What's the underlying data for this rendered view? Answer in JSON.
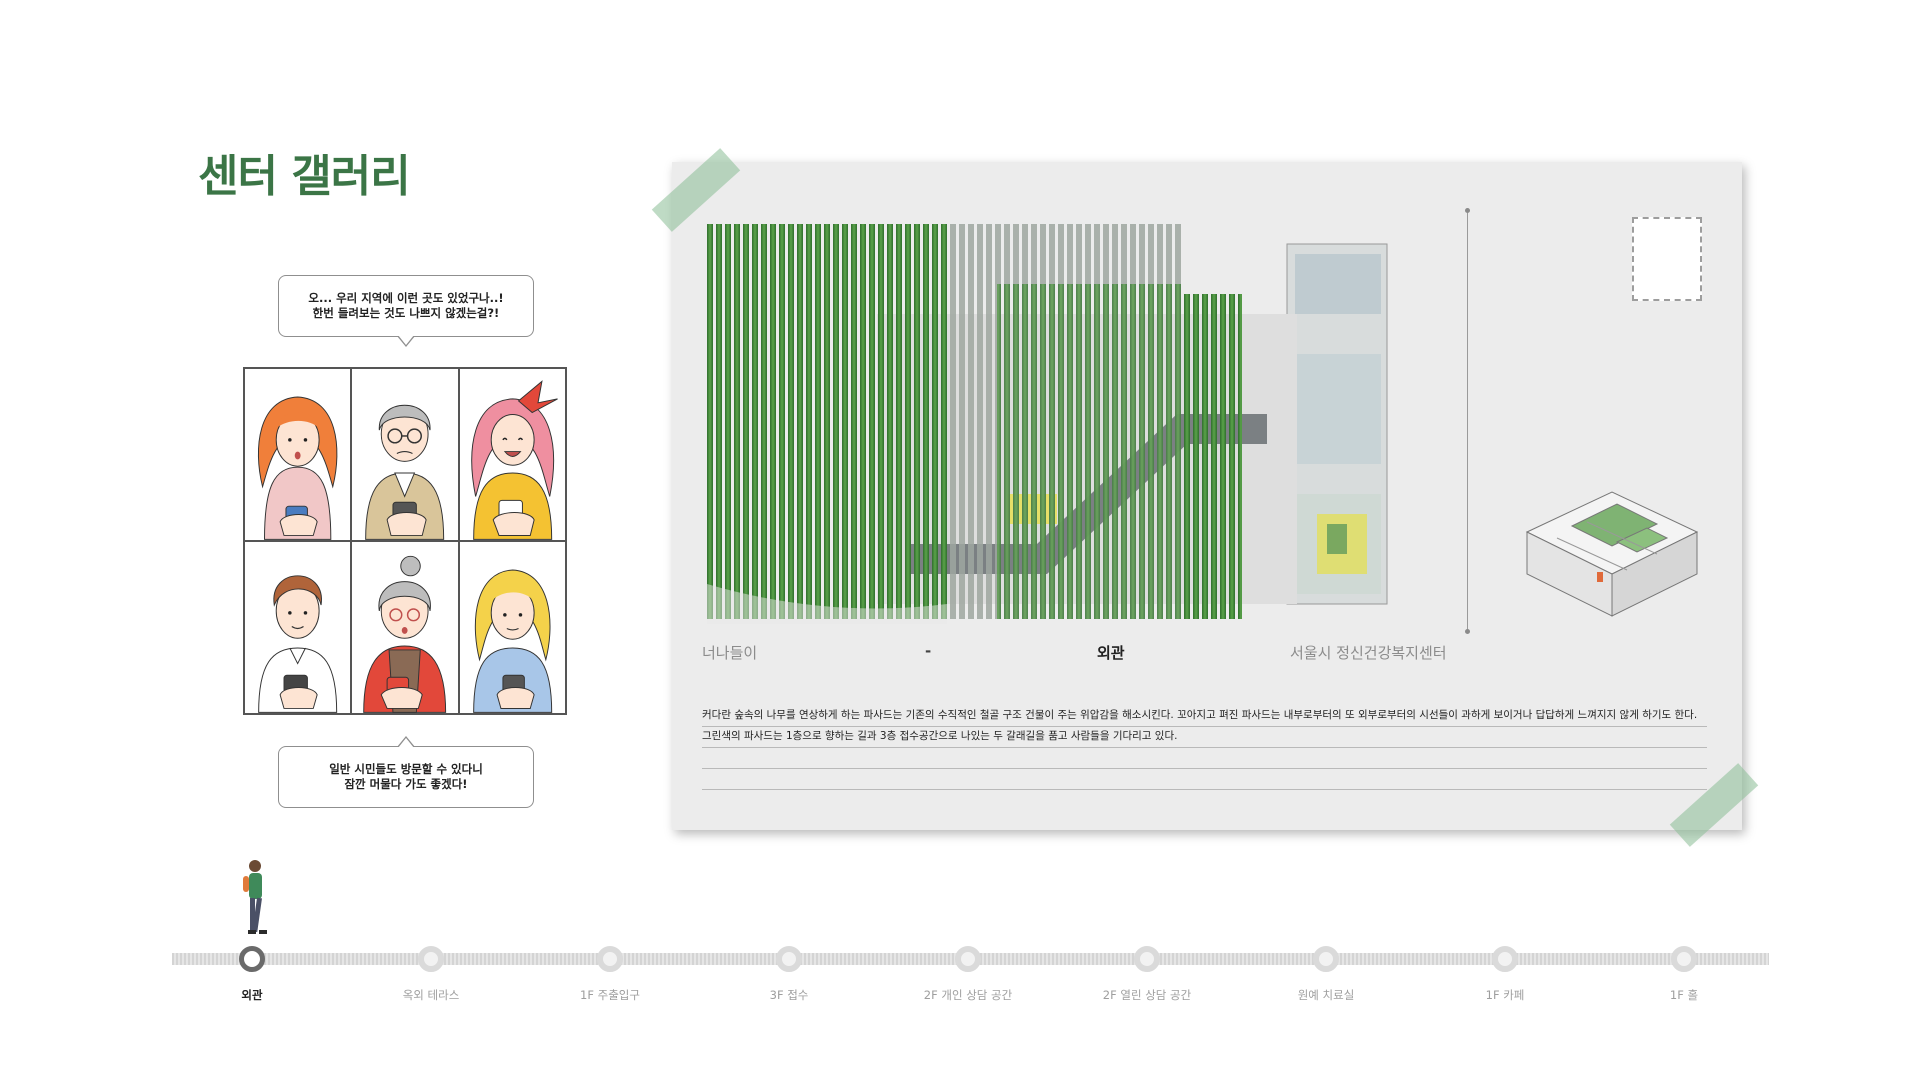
{
  "page": {
    "title": "센터 갤러리"
  },
  "speech": {
    "top": [
      "오... 우리 지역에 이런 곳도 있었구나..!",
      "한번 들려보는 것도 나쁘지 않겠는걸?!"
    ],
    "bottom": [
      "일반 시민들도 방문할 수 있다니",
      "잠깐 머물다 가도 좋겠다!"
    ]
  },
  "postcard": {
    "caption_left": "너나들이",
    "caption_dash": "-",
    "caption_center": "외관",
    "caption_right": "서울시 정신건강복지센터",
    "description": [
      "커다란 숲속의 나무를 연상하게 하는  파사드는 기존의 수직적인 철골 구조 건물이 주는 위압감을 해소시킨다.  꼬아지고 펴진 파사드는 내부로부터의 또 외부로부터의 시선들이 과하게 보이거나 답답하게 느껴지지 않게 하기도 한다.",
      "그린색의 파사드는 1층으로 향하는 길과 3층 접수공간으로 나있는 두 갈래길을 품고 사람들을 기다리고 있다.",
      "",
      ""
    ]
  },
  "timeline": {
    "active_index": 0,
    "stops": [
      "외관",
      "옥외 테라스",
      "1F 주출입구",
      "3F 접수",
      "2F 개인 상담 공간",
      "2F 열린 상담 공간",
      "원예 치료실",
      "1F 카페",
      "1F 홀"
    ]
  },
  "colors": {
    "title_green": "#3b7546",
    "facade_green": "#3f8a3a",
    "tape_green": "#8abe96"
  }
}
